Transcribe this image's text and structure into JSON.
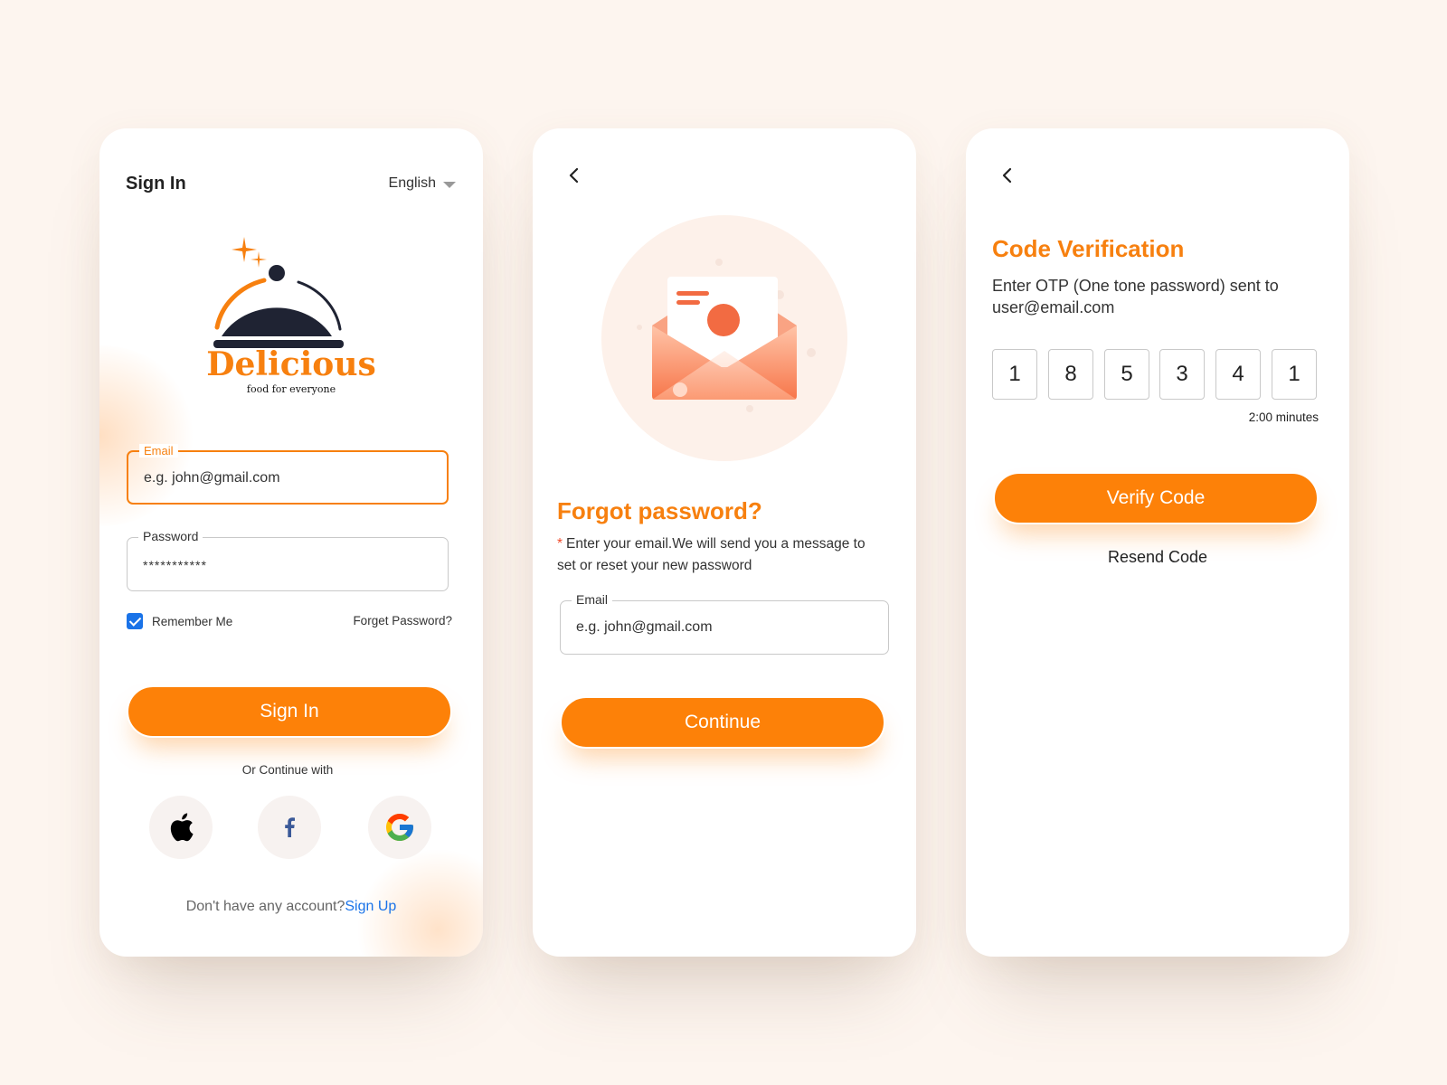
{
  "signin": {
    "title": "Sign In",
    "language": "English",
    "brand_name": "Delicious",
    "tagline": "food for everyone",
    "email_label": "Email",
    "email_placeholder": "e.g. john@gmail.com",
    "password_label": "Password",
    "password_value": "***********",
    "remember_label": "Remember Me",
    "remember_checked": true,
    "forget_link": "Forget Password?",
    "submit_label": "Sign In",
    "or_text": "Or Continue with",
    "social": [
      "apple-icon",
      "facebook-icon",
      "google-icon"
    ],
    "no_account_text": "Don't have any account?",
    "signup_link": "Sign Up"
  },
  "forgot": {
    "title": "Forgot password?",
    "required_mark": "*",
    "description": "Enter your email.We will send you a message to set or reset your new password",
    "email_label": "Email",
    "email_placeholder": "e.g. john@gmail.com",
    "submit_label": "Continue"
  },
  "verify": {
    "title": "Code Verification",
    "description": "Enter OTP (One tone password) sent to user@email.com",
    "otp": [
      "1",
      "8",
      "5",
      "3",
      "4",
      "1"
    ],
    "timer": "2:00 minutes",
    "submit_label": "Verify Code",
    "resend_label": "Resend Code"
  },
  "colors": {
    "accent": "#fd8108",
    "title_orange": "#f7800f",
    "link_blue": "#1a73e8",
    "background": "#fdf5ef",
    "dark_navy": "#1f2333"
  }
}
